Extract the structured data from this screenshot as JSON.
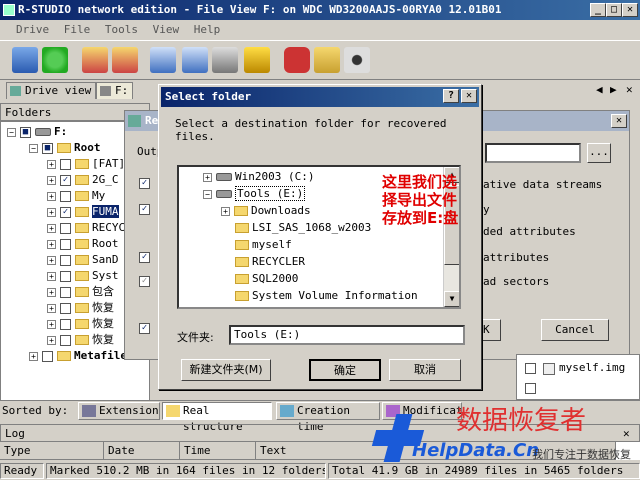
{
  "window": {
    "title": "R-STUDIO network edition - File View F: on WDC WD3200AAJS-00RYA0 12.01B01"
  },
  "menu": [
    "Drive",
    "File",
    "Tools",
    "View",
    "Help"
  ],
  "tabs": [
    {
      "label": "Drive view"
    },
    {
      "label": "F:"
    }
  ],
  "folders_panel": {
    "title": "Folders"
  },
  "tree": [
    {
      "label": "F:"
    },
    {
      "label": "Root"
    },
    {
      "label": "[FAT]"
    },
    {
      "label": "2G_C"
    },
    {
      "label": "My"
    },
    {
      "label": "FUMA"
    },
    {
      "label": "RECYC"
    },
    {
      "label": "Root"
    },
    {
      "label": "SanD"
    },
    {
      "label": "Syst"
    },
    {
      "label": "包含"
    },
    {
      "label": "恢复"
    },
    {
      "label": "恢复"
    },
    {
      "label": "恢复"
    },
    {
      "label": "Metafiles"
    }
  ],
  "back_dialog": {
    "title_prefix": "Re",
    "output_label": "Outp",
    "options": [
      "ative data streams",
      "y",
      "ded attributes",
      "attributes",
      "ad sectors"
    ],
    "ok_label": "OK",
    "cancel_label": "Cancel",
    "browse_label": "...",
    "file_label": "myself.img"
  },
  "select_dialog": {
    "title": "Select folder",
    "instruction": "Select a destination folder for recovered files.",
    "tree": [
      {
        "label": "Win2003 (C:)"
      },
      {
        "label": "Tools (E:)"
      },
      {
        "label": "Downloads"
      },
      {
        "label": "LSI_SAS_1068_w2003"
      },
      {
        "label": "myself"
      },
      {
        "label": "RECYCLER"
      },
      {
        "label": "SQL2000"
      },
      {
        "label": "System Volume Information"
      }
    ],
    "folder_label": "文件夹:",
    "folder_value": "Tools (E:)",
    "new_folder_label": "新建文件夹(M)",
    "ok_label": "确定",
    "cancel_label": "取消"
  },
  "annotation": [
    "这里我们选",
    "择导出文件",
    "存放到E:盘"
  ],
  "sortbar": {
    "label": "Sorted by:",
    "buttons": [
      "Extension",
      "Real structure",
      "Creation time",
      "Modificatio"
    ]
  },
  "log": {
    "title": "Log",
    "columns": [
      "Type",
      "Date",
      "Time",
      "Text"
    ]
  },
  "status": {
    "state": "Ready",
    "marked": "Marked 510.2 MB in 164 files in 12 folders",
    "total": "Total 41.9 GB in 24989 files in 5465 folders"
  },
  "watermark": {
    "cn": "数据恢复者",
    "url": "HelpData.Cn",
    "slogan": "我们专注于数据恢复"
  }
}
